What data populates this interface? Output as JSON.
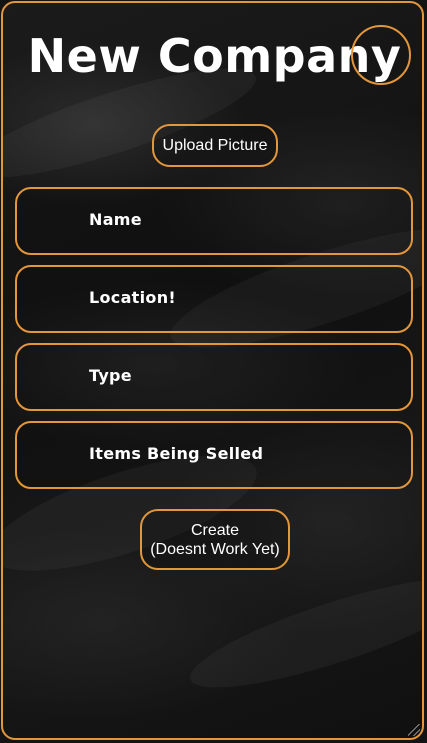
{
  "header": {
    "title": "New Company"
  },
  "upload": {
    "label": "Upload Picture"
  },
  "form": {
    "fields": [
      {
        "label": "Name"
      },
      {
        "label": "Location!"
      },
      {
        "label": "Type"
      },
      {
        "label": "Items Being Selled"
      }
    ]
  },
  "create": {
    "line1": "Create",
    "line2": "(Doesnt Work Yet)"
  },
  "colors": {
    "accent": "#e3963a",
    "background": "#141414",
    "text": "#ffffff"
  }
}
